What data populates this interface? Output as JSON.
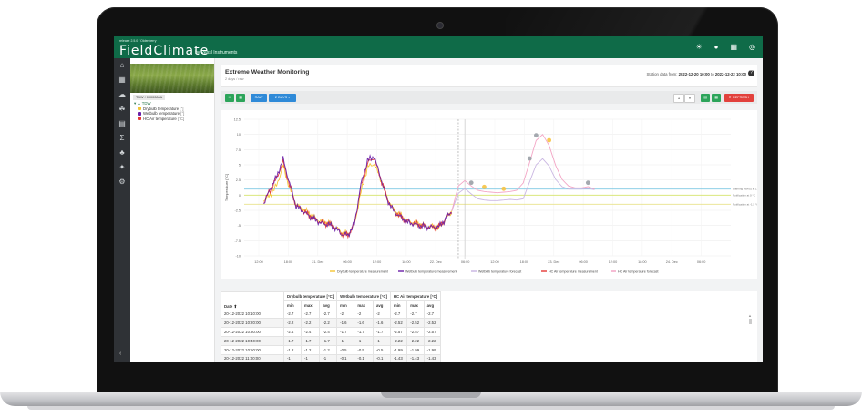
{
  "app": {
    "version": "release 2.5.0 / Oldenberry",
    "brand": "FieldClimate",
    "brand_sub": "by Pessl Instruments",
    "accent": "#0f6b48"
  },
  "top_icons": [
    "bell-icon",
    "user-icon",
    "users-icon",
    "antenna-icon"
  ],
  "rail_icons": [
    "home-icon",
    "dashboard-icon",
    "weather-icon",
    "plant-icon",
    "map-icon",
    "sum-icon",
    "leaf-icon",
    "satellite-icon",
    "settings-icon"
  ],
  "station": {
    "name": "TDW / 0000084A",
    "tree_root": "TDW",
    "sensors": [
      {
        "label": "Drybulb temperature",
        "unit": "[°]",
        "color": "#f4c531"
      },
      {
        "label": "Wetbulb temperature",
        "unit": "[°]",
        "color": "#6a1fa8"
      },
      {
        "label": "HC Air temperature",
        "unit": "[°C]",
        "color": "#e53935"
      }
    ]
  },
  "page": {
    "title": "Extreme Weather Monitoring",
    "subtitle": "2 days / raw",
    "date_prefix": "Station data from:",
    "date_from": "2022-12-20 10:00",
    "date_to_word": "to",
    "date_to": "2022-12-22 10:00"
  },
  "toolbar": {
    "btn_h": "H",
    "btn_raw": "RAW",
    "btn_range": "2 DAYS ▾",
    "btn_refresh": "⟳ REFRESH",
    "colors": {
      "green": "#2ca45a",
      "blue": "#2f8ad8",
      "red": "#e2413c"
    }
  },
  "chart_data": {
    "type": "line",
    "ylabel": "Temperature [°C]",
    "ylim": [
      -10,
      12.5
    ],
    "yticks": [
      "12.5",
      "10",
      "7.5",
      "5",
      "2.5",
      "0",
      "-2.5",
      "-5",
      "-7.5",
      "-10"
    ],
    "xticks": [
      "12:00",
      "18:00",
      "21. Dec",
      "06:00",
      "12:00",
      "18:00",
      "22. Dec",
      "06:00",
      "12:00",
      "18:00",
      "23. Dec",
      "06:00",
      "12:00",
      "18:00",
      "24. Dec",
      "06:00"
    ],
    "x_hours": [
      0,
      2,
      4,
      6,
      8,
      10,
      12,
      14,
      16,
      18,
      20,
      22,
      24,
      26,
      28,
      30,
      32,
      34,
      36,
      38,
      40,
      42,
      44,
      46,
      48,
      50,
      52,
      54,
      56,
      58,
      60,
      62,
      64,
      66,
      68,
      70,
      72,
      74,
      76,
      78,
      80,
      82,
      84,
      86,
      88,
      90,
      92,
      94,
      96,
      98,
      100,
      102,
      104,
      106,
      108,
      110,
      112,
      114,
      116,
      118,
      120,
      122,
      124,
      126,
      128,
      130,
      132,
      134,
      136,
      138,
      140,
      142,
      144,
      146,
      148,
      150,
      152,
      154,
      156,
      158,
      160,
      162,
      164,
      166,
      168,
      170,
      172,
      174,
      176,
      178,
      180,
      182,
      184,
      186,
      188,
      190,
      192,
      194,
      196,
      198,
      200
    ],
    "annotations": [
      "Warning (NWS) at 1 °C",
      "Notification at 0 °C",
      "Notification at -1.5 °C"
    ],
    "thresholds": [
      {
        "value": 1,
        "color": "#7ec8e3"
      },
      {
        "value": 0,
        "color": "#d6e46a"
      },
      {
        "value": -1.5,
        "color": "#e8e28a"
      }
    ],
    "series": [
      {
        "name": "Drybulb temperature measurement",
        "color": "#f4c531",
        "points": [
          [
            6,
            -1
          ],
          [
            8,
            0
          ],
          [
            10,
            1.6
          ],
          [
            12,
            4.8
          ],
          [
            14,
            1.2
          ],
          [
            16,
            -1.5
          ],
          [
            18,
            -2.3
          ],
          [
            20,
            -3
          ],
          [
            22,
            -3.8
          ],
          [
            24,
            -4.4
          ],
          [
            26,
            -4.6
          ],
          [
            28,
            -5.2
          ],
          [
            30,
            -6.2
          ],
          [
            32,
            -6.5
          ],
          [
            34,
            -4.8
          ],
          [
            36,
            0.5
          ],
          [
            38,
            4.6
          ],
          [
            40,
            5.2
          ],
          [
            42,
            2.8
          ],
          [
            44,
            -0.3
          ],
          [
            46,
            -2.4
          ],
          [
            48,
            -3.3
          ],
          [
            50,
            -4.2
          ],
          [
            52,
            -4.5
          ],
          [
            54,
            -4.8
          ],
          [
            56,
            -5.1
          ],
          [
            58,
            -5.2
          ],
          [
            60,
            -5.3
          ],
          [
            62,
            -4.1
          ],
          [
            64,
            -2.6
          ]
        ]
      },
      {
        "name": "Wetbulb temperature measurement",
        "color": "#6a1fa8",
        "points": [
          [
            6,
            -1.4
          ],
          [
            8,
            1
          ],
          [
            10,
            3
          ],
          [
            12,
            6
          ],
          [
            14,
            1.9
          ],
          [
            16,
            -1.8
          ],
          [
            18,
            -2.6
          ],
          [
            20,
            -3.4
          ],
          [
            22,
            -4.1
          ],
          [
            24,
            -4.7
          ],
          [
            26,
            -4.8
          ],
          [
            28,
            -5.4
          ],
          [
            30,
            -6.4
          ],
          [
            32,
            -6.6
          ],
          [
            34,
            -4.7
          ],
          [
            36,
            1.8
          ],
          [
            38,
            5.7
          ],
          [
            40,
            6.4
          ],
          [
            42,
            3
          ],
          [
            44,
            -0.6
          ],
          [
            46,
            -2.6
          ],
          [
            48,
            -3.5
          ],
          [
            50,
            -4.4
          ],
          [
            52,
            -4.7
          ],
          [
            54,
            -5
          ],
          [
            56,
            -5.2
          ],
          [
            58,
            -5.3
          ],
          [
            60,
            -5.2
          ],
          [
            62,
            -4
          ],
          [
            64,
            -2.6
          ]
        ]
      },
      {
        "name": "Wetbulb temperature forecast",
        "color": "#c7b3e0",
        "points": [
          [
            64,
            -2.6
          ],
          [
            66,
            0.3
          ],
          [
            68,
            1.1
          ],
          [
            70,
            0.2
          ],
          [
            72,
            -0.6
          ],
          [
            74,
            -0.8
          ],
          [
            76,
            -0.9
          ],
          [
            78,
            -0.9
          ],
          [
            80,
            -0.8
          ],
          [
            82,
            -0.7
          ],
          [
            84,
            -0.8
          ],
          [
            86,
            -0.6
          ],
          [
            88,
            2.2
          ],
          [
            90,
            5
          ],
          [
            92,
            6
          ],
          [
            94,
            4.8
          ],
          [
            96,
            2.6
          ],
          [
            98,
            1.4
          ],
          [
            100,
            1
          ],
          [
            102,
            1
          ],
          [
            104,
            1
          ],
          [
            106,
            1.1
          ],
          [
            108,
            0.9
          ]
        ]
      },
      {
        "name": "HC Air temperature measurement",
        "color": "#e53935",
        "points": [
          [
            6,
            -1.2
          ],
          [
            8,
            0.8
          ],
          [
            10,
            2.8
          ],
          [
            12,
            5.5
          ],
          [
            14,
            1.6
          ],
          [
            16,
            -1.7
          ],
          [
            18,
            -2.5
          ],
          [
            20,
            -3.3
          ],
          [
            22,
            -4
          ],
          [
            24,
            -4.6
          ],
          [
            26,
            -4.7
          ],
          [
            28,
            -5.3
          ],
          [
            30,
            -6.3
          ],
          [
            32,
            -6.6
          ],
          [
            34,
            -4.7
          ],
          [
            36,
            1.4
          ],
          [
            38,
            5.3
          ],
          [
            40,
            6.2
          ],
          [
            42,
            2.9
          ],
          [
            44,
            -0.5
          ],
          [
            46,
            -2.5
          ],
          [
            48,
            -3.4
          ],
          [
            50,
            -4.3
          ],
          [
            52,
            -4.6
          ],
          [
            54,
            -4.9
          ],
          [
            56,
            -5.2
          ],
          [
            58,
            -5.3
          ],
          [
            60,
            -5.2
          ],
          [
            62,
            -4
          ],
          [
            64,
            -2.6
          ]
        ]
      },
      {
        "name": "HC Air temperature forecast",
        "color": "#f2a0c2",
        "points": [
          [
            64,
            -2.6
          ],
          [
            66,
            1.5
          ],
          [
            68,
            2.4
          ],
          [
            70,
            1.5
          ],
          [
            72,
            0.8
          ],
          [
            74,
            0.6
          ],
          [
            76,
            0.5
          ],
          [
            78,
            0.4
          ],
          [
            80,
            0.5
          ],
          [
            82,
            0.6
          ],
          [
            84,
            0.8
          ],
          [
            86,
            2
          ],
          [
            88,
            5.4
          ],
          [
            90,
            9
          ],
          [
            92,
            10
          ],
          [
            94,
            8.2
          ],
          [
            96,
            4.9
          ],
          [
            98,
            2.6
          ],
          [
            100,
            1.5
          ],
          [
            102,
            1.2
          ],
          [
            104,
            1.2
          ],
          [
            106,
            1.4
          ],
          [
            108,
            1
          ]
        ]
      }
    ]
  },
  "table": {
    "headers": {
      "date": "Date ⬆",
      "g1": "Drybulb temperature [°C]",
      "g2": "Wetbulb temperature [°C]",
      "g3": "HC Air temperature [°C]"
    },
    "sub": [
      "min",
      "max",
      "avg",
      "min",
      "max",
      "avg",
      "min",
      "max",
      "avg"
    ],
    "rows": [
      [
        "20-12-2022 10:10:00",
        "-2.7",
        "-2.7",
        "-2.7",
        "-2",
        "-2",
        "-2",
        "-2.7",
        "-2.7",
        "-2.7"
      ],
      [
        "20-12-2022 10:20:00",
        "-2.2",
        "-2.2",
        "-2.2",
        "-1.6",
        "-1.6",
        "-1.6",
        "-2.52",
        "-2.52",
        "-2.52"
      ],
      [
        "20-12-2022 10:30:00",
        "-2.4",
        "-2.4",
        "-2.4",
        "-1.7",
        "-1.7",
        "-1.7",
        "-2.57",
        "-2.57",
        "-2.57"
      ],
      [
        "20-12-2022 10:40:00",
        "-1.7",
        "-1.7",
        "-1.7",
        "-1",
        "-1",
        "-1",
        "-2.22",
        "-2.22",
        "-2.22"
      ],
      [
        "20-12-2022 10:50:00",
        "-1.2",
        "-1.2",
        "-1.2",
        "-0.5",
        "-0.5",
        "-0.5",
        "-1.99",
        "-1.99",
        "-1.99"
      ],
      [
        "20-12-2022 11:00:00",
        "-1",
        "-1",
        "-1",
        "-0.1",
        "-0.1",
        "-0.1",
        "-1.43",
        "-1.43",
        "-1.43"
      ]
    ]
  }
}
